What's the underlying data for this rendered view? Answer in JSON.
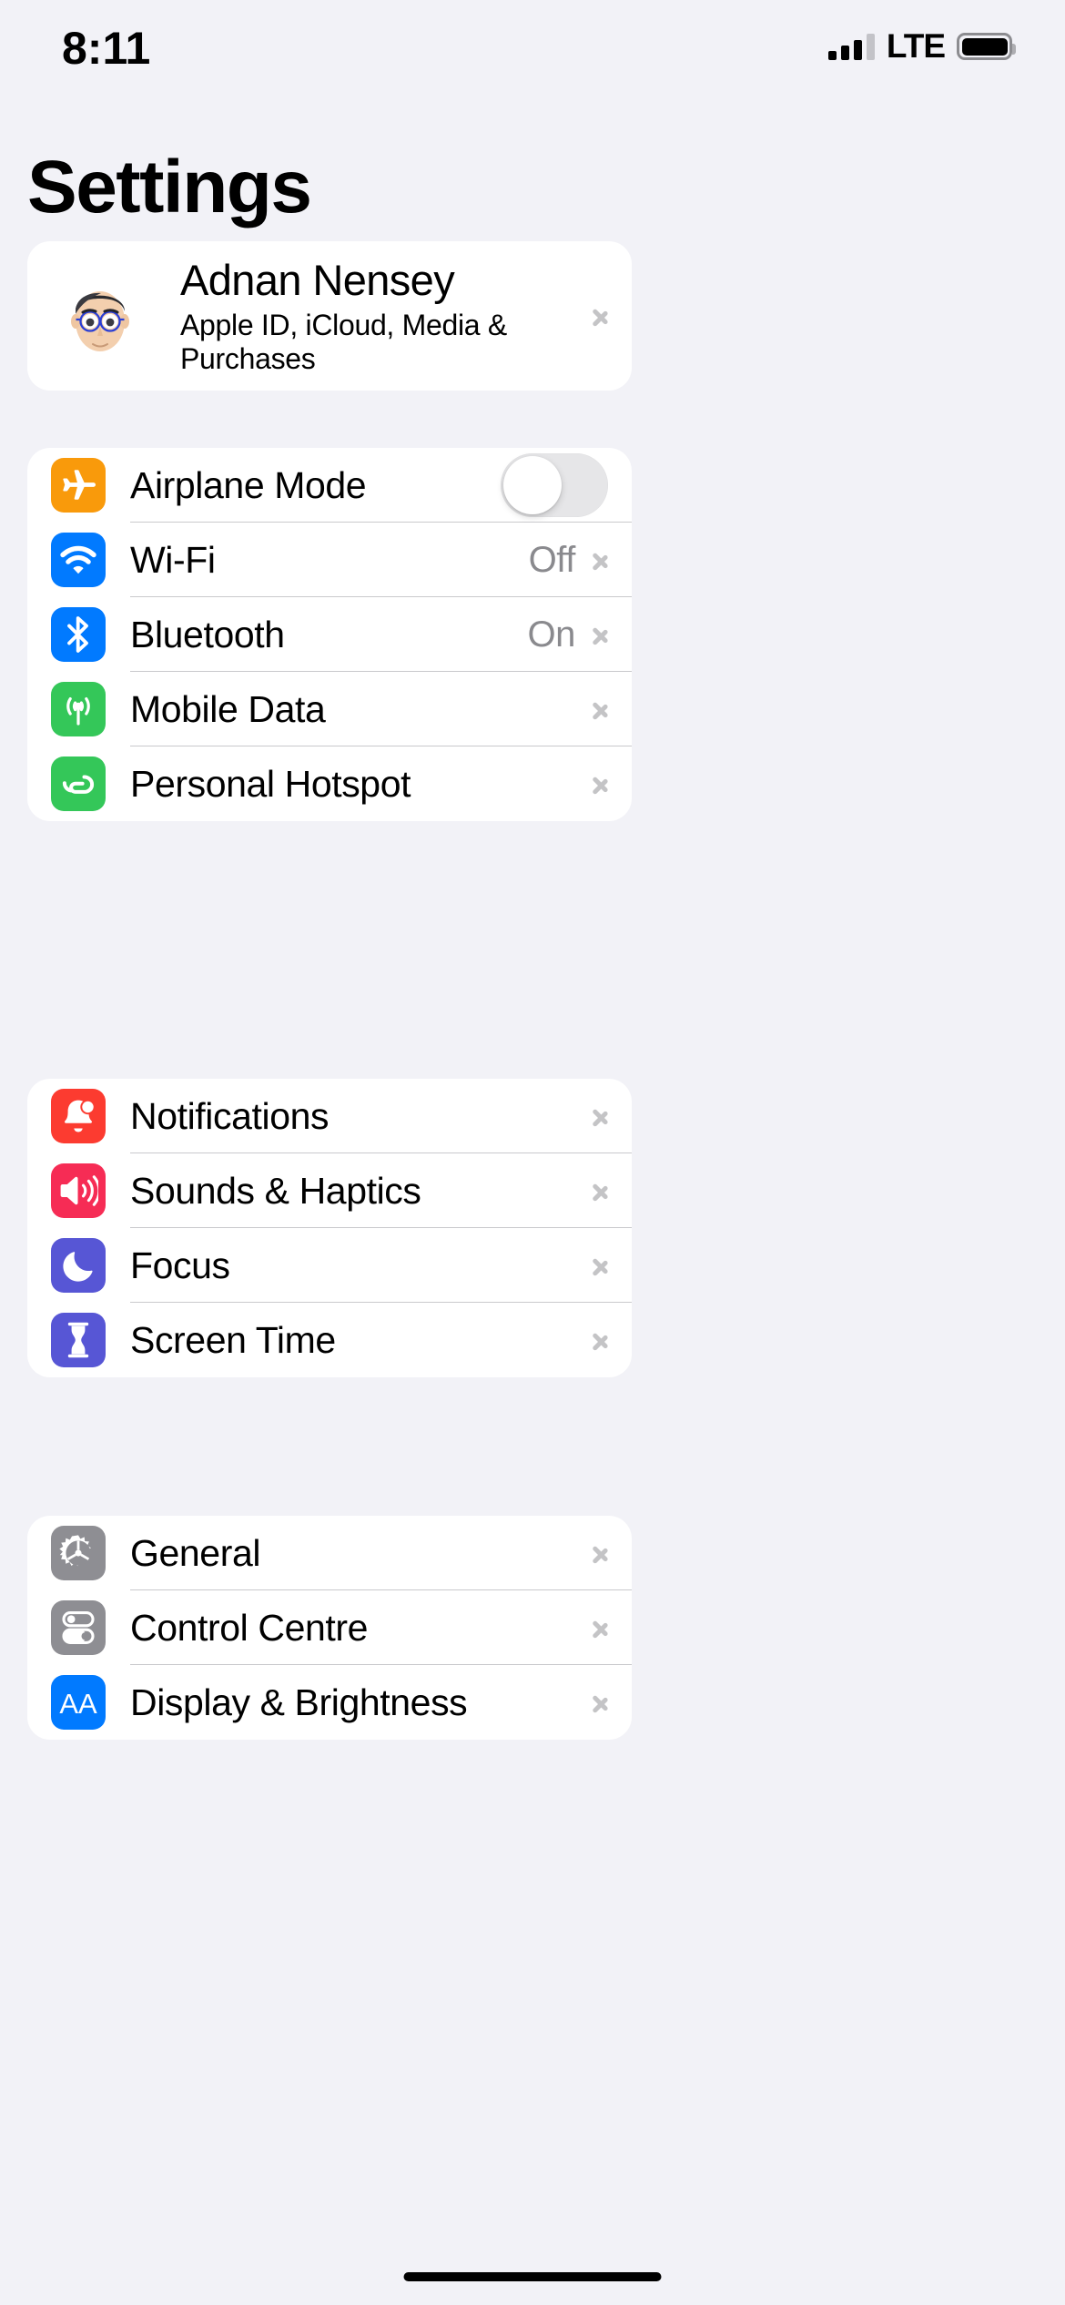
{
  "status_bar": {
    "time": "8:11",
    "network_type": "LTE",
    "signal_icon": "cellular-signal-icon",
    "battery_icon": "battery-icon",
    "signal_bars_filled": 3,
    "signal_bars_total": 4
  },
  "header": {
    "title": "Settings"
  },
  "profile": {
    "avatar_icon": "memoji-avatar",
    "name": "Adnan Nensey",
    "subtitle": "Apple ID, iCloud, Media & Purchases",
    "chevron_icon": "chevron-right-icon"
  },
  "colors": {
    "background": "#F2F2F7",
    "card": "#FFFFFF",
    "separator": "#C9C9CC",
    "value_text": "#8A8A8E",
    "chevron": "#C4C4C6",
    "orange": "#F99A0B",
    "blue": "#017AFF",
    "green": "#34C759",
    "red": "#FC3B30",
    "pink": "#F62C55",
    "indigo": "#5756D5",
    "gray": "#8E8E93",
    "toggle_off_track": "#E6E6E8"
  },
  "groups": [
    {
      "name": "connectivity",
      "rows": [
        {
          "label": "Airplane Mode",
          "icon": "airplane-icon",
          "icon_color": "#F99A0B",
          "accessory": "toggle",
          "toggle_on": false
        },
        {
          "label": "Wi-Fi",
          "icon": "wifi-icon",
          "icon_color": "#017AFF",
          "accessory": "value",
          "value": "Off"
        },
        {
          "label": "Bluetooth",
          "icon": "bluetooth-icon",
          "icon_color": "#017AFF",
          "accessory": "value",
          "value": "On"
        },
        {
          "label": "Mobile Data",
          "icon": "mobile-data-icon",
          "icon_color": "#34C759",
          "accessory": "chevron",
          "value": ""
        },
        {
          "label": "Personal Hotspot",
          "icon": "personal-hotspot-icon",
          "icon_color": "#34C759",
          "accessory": "chevron",
          "value": ""
        }
      ]
    },
    {
      "name": "alerts",
      "rows": [
        {
          "label": "Notifications",
          "icon": "bell-icon",
          "icon_color": "#FC3B30",
          "accessory": "chevron",
          "value": ""
        },
        {
          "label": "Sounds & Haptics",
          "icon": "speaker-icon",
          "icon_color": "#F62C55",
          "accessory": "chevron",
          "value": ""
        },
        {
          "label": "Focus",
          "icon": "moon-icon",
          "icon_color": "#5756D5",
          "accessory": "chevron",
          "value": ""
        },
        {
          "label": "Screen Time",
          "icon": "hourglass-icon",
          "icon_color": "#5756D5",
          "accessory": "chevron",
          "value": ""
        }
      ]
    },
    {
      "name": "system",
      "rows": [
        {
          "label": "General",
          "icon": "gear-icon",
          "icon_color": "#8E8E93",
          "accessory": "chevron",
          "value": ""
        },
        {
          "label": "Control Centre",
          "icon": "control-centre-icon",
          "icon_color": "#8E8E93",
          "accessory": "chevron",
          "value": ""
        },
        {
          "label": "Display & Brightness",
          "icon": "display-aa-icon",
          "icon_color": "#017AFF",
          "accessory": "chevron",
          "value": ""
        }
      ]
    }
  ]
}
